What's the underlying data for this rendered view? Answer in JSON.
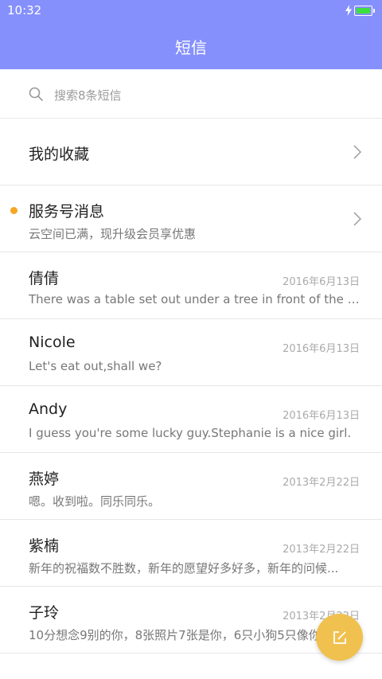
{
  "status_bar": {
    "time": "10:32",
    "charging_icon": "bolt-icon",
    "battery_icon": "battery-icon"
  },
  "header": {
    "title": "短信",
    "background_color": "#8590fc"
  },
  "search": {
    "icon": "search-icon",
    "placeholder": "搜索8条短信"
  },
  "favorites": {
    "label": "我的收藏",
    "icon": "chevron-right-icon"
  },
  "service": {
    "label": "服务号消息",
    "preview": "云空间已满，现升级会员享优惠",
    "unread_dot_color": "#f5a623"
  },
  "messages": [
    {
      "name": "倩倩",
      "date": "2016年6月13日",
      "preview": "There was a table set out under a tree in front of the house..."
    },
    {
      "name": "Nicole",
      "date": "2016年6月13日",
      "preview": "Let's eat out,shall we?"
    },
    {
      "name": "Andy",
      "date": "2016年6月13日",
      "preview": "I guess you're some lucky guy.Stephanie is a nice girl."
    },
    {
      "name": "燕婷",
      "date": "2013年2月22日",
      "preview": "嗯。收到啦。同乐同乐。"
    },
    {
      "name": "紫楠",
      "date": "2013年2月22日",
      "preview": "新年的祝福数不胜数，新年的愿望好多好多，新年的问候..."
    },
    {
      "name": "子玲",
      "date": "2013年2月22日",
      "preview": "10分想念9别的你，8张照片7张是你，6只小狗5只像你..."
    }
  ],
  "fab": {
    "icon": "compose-icon",
    "color": "#f0c14e"
  }
}
